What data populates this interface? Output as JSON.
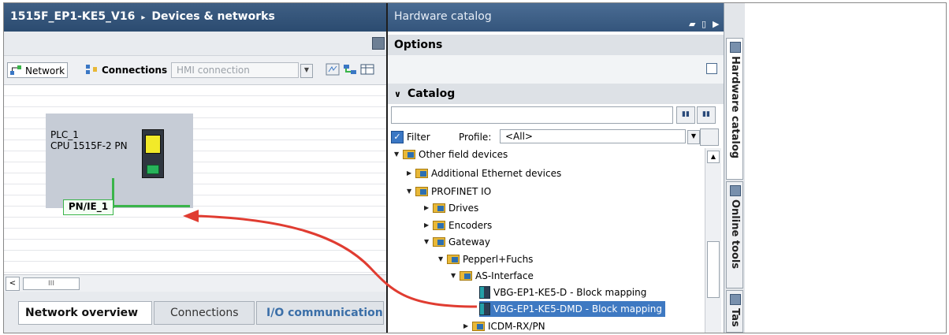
{
  "left_panel": {
    "title_project": "1515F_EP1-KE5_V16",
    "title_separator": "▸",
    "title_section": "Devices & networks",
    "toolbar": {
      "network_label": "Network",
      "connections_label": "Connections",
      "hmi_connection_value": "HMI connection"
    },
    "plc": {
      "name": "PLC_1",
      "cpu": "CPU 1515F-2 PN"
    },
    "subnet_label": "PN/IE_1",
    "scroll_thumb": "III",
    "tabs": [
      "Network overview",
      "Connections",
      "I/O communication"
    ]
  },
  "right_panel": {
    "title": "Hardware catalog",
    "options_header": "Options",
    "catalog_header": "Catalog",
    "search_value": "",
    "filter_label": "Filter",
    "profile_label": "Profile:",
    "profile_value": "<All>",
    "tree": [
      {
        "label": "Other field devices",
        "level": 0,
        "state": "expanded",
        "icon": "folder-icon"
      },
      {
        "label": "Additional Ethernet devices",
        "level": 1,
        "state": "collapsed",
        "icon": "folder-icon"
      },
      {
        "label": "PROFINET IO",
        "level": 1,
        "state": "expanded",
        "icon": "folder-icon"
      },
      {
        "label": "Drives",
        "level": 2,
        "state": "collapsed",
        "icon": "folder-icon"
      },
      {
        "label": "Encoders",
        "level": 2,
        "state": "collapsed",
        "icon": "folder-icon"
      },
      {
        "label": "Gateway",
        "level": 2,
        "state": "expanded",
        "icon": "folder-icon"
      },
      {
        "label": "Pepperl+Fuchs",
        "level": 3,
        "state": "expanded",
        "icon": "folder-icon"
      },
      {
        "label": "AS-Interface",
        "level": 4,
        "state": "expanded",
        "icon": "folder-icon"
      },
      {
        "label": "VBG-EP1-KE5-D - Block mapping",
        "level": 5,
        "state": "leaf",
        "icon": "device-icon"
      },
      {
        "label": "VBG-EP1-KE5-DMD - Block mapping",
        "level": 5,
        "state": "selected",
        "icon": "device-icon"
      },
      {
        "label": "ICDM-RX/PN",
        "level": 4,
        "state": "collapsed",
        "icon": "folder-icon"
      }
    ]
  },
  "side_tabs": [
    "Hardware catalog",
    "Online tools",
    "Tas"
  ],
  "colors": {
    "title_bar": "#2b4b70",
    "selection": "#3e79c2",
    "subnet_green": "#3ab44a",
    "drag_arrow": "#e03c31"
  },
  "icons": [
    "network-icon",
    "connections-icon",
    "device-icon",
    "folder-icon",
    "plc-cpu-icon"
  ]
}
